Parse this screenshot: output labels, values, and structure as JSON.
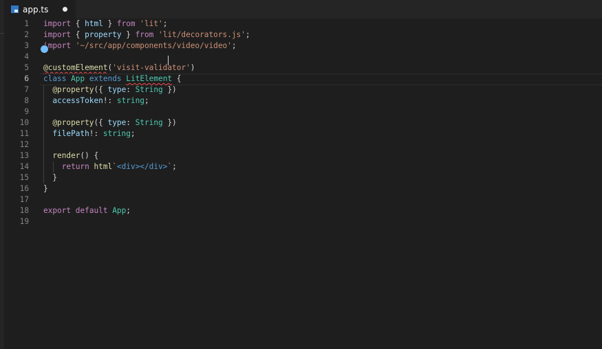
{
  "tab": {
    "filename": "app.ts"
  },
  "lines": [
    {
      "n": "1",
      "tokens": [
        [
          "k",
          "import"
        ],
        [
          "p",
          " { "
        ],
        [
          "v",
          "html"
        ],
        [
          "p",
          " } "
        ],
        [
          "k",
          "from"
        ],
        [
          "p",
          " "
        ],
        [
          "s",
          "'lit'"
        ],
        [
          "p",
          ";"
        ]
      ]
    },
    {
      "n": "2",
      "tokens": [
        [
          "k",
          "import"
        ],
        [
          "p",
          " { "
        ],
        [
          "v",
          "property"
        ],
        [
          "p",
          " } "
        ],
        [
          "k",
          "from"
        ],
        [
          "p",
          " "
        ],
        [
          "s",
          "'lit/decorators.js'"
        ],
        [
          "p",
          ";"
        ]
      ]
    },
    {
      "n": "3",
      "tokens": [
        [
          "k",
          "import"
        ],
        [
          "p",
          " "
        ],
        [
          "s",
          "'~/src/app/components/video/video'"
        ],
        [
          "p",
          ";"
        ]
      ]
    },
    {
      "n": "4",
      "tokens": []
    },
    {
      "n": "5",
      "tokens": [
        [
          "f",
          "@customElement",
          "squig"
        ],
        [
          "p",
          "("
        ],
        [
          "s",
          "'visit-validator'"
        ],
        [
          "p",
          ")"
        ]
      ]
    },
    {
      "n": "6",
      "current": true,
      "tokens": [
        [
          "b",
          "class"
        ],
        [
          "p",
          " "
        ],
        [
          "t",
          "App"
        ],
        [
          "p",
          " "
        ],
        [
          "b",
          "extends"
        ],
        [
          "p",
          " "
        ],
        [
          "t",
          "LitElement",
          "squig"
        ],
        [
          "p",
          " {"
        ]
      ]
    },
    {
      "n": "7",
      "tokens": [
        [
          "p",
          "  "
        ],
        [
          "f",
          "@property"
        ],
        [
          "p",
          "({ "
        ],
        [
          "v",
          "type"
        ],
        [
          "p",
          ": "
        ],
        [
          "t",
          "String"
        ],
        [
          "p",
          " })"
        ]
      ]
    },
    {
      "n": "8",
      "tokens": [
        [
          "p",
          "  "
        ],
        [
          "v",
          "accessToken"
        ],
        [
          "p",
          "!: "
        ],
        [
          "t",
          "string"
        ],
        [
          "p",
          ";"
        ]
      ]
    },
    {
      "n": "9",
      "tokens": []
    },
    {
      "n": "10",
      "tokens": [
        [
          "p",
          "  "
        ],
        [
          "f",
          "@property"
        ],
        [
          "p",
          "({ "
        ],
        [
          "v",
          "type"
        ],
        [
          "p",
          ": "
        ],
        [
          "t",
          "String"
        ],
        [
          "p",
          " })"
        ]
      ]
    },
    {
      "n": "11",
      "tokens": [
        [
          "p",
          "  "
        ],
        [
          "v",
          "filePath"
        ],
        [
          "p",
          "!: "
        ],
        [
          "t",
          "string"
        ],
        [
          "p",
          ";"
        ]
      ]
    },
    {
      "n": "12",
      "tokens": []
    },
    {
      "n": "13",
      "tokens": [
        [
          "p",
          "  "
        ],
        [
          "f",
          "render"
        ],
        [
          "p",
          "() {"
        ]
      ]
    },
    {
      "n": "14",
      "tokens": [
        [
          "p",
          "    "
        ],
        [
          "k",
          "return"
        ],
        [
          "p",
          " "
        ],
        [
          "f",
          "html"
        ],
        [
          "s",
          "`"
        ],
        [
          "b",
          "<div></div>"
        ],
        [
          "s",
          "`"
        ],
        [
          "p",
          ";"
        ]
      ]
    },
    {
      "n": "15",
      "tokens": [
        [
          "p",
          "  }"
        ]
      ]
    },
    {
      "n": "16",
      "tokens": [
        [
          "p",
          "}"
        ]
      ]
    },
    {
      "n": "17",
      "tokens": []
    },
    {
      "n": "18",
      "tokens": [
        [
          "k",
          "export"
        ],
        [
          "p",
          " "
        ],
        [
          "k",
          "default"
        ],
        [
          "p",
          " "
        ],
        [
          "t",
          "App"
        ],
        [
          "p",
          ";"
        ]
      ]
    },
    {
      "n": "19",
      "tokens": []
    }
  ]
}
